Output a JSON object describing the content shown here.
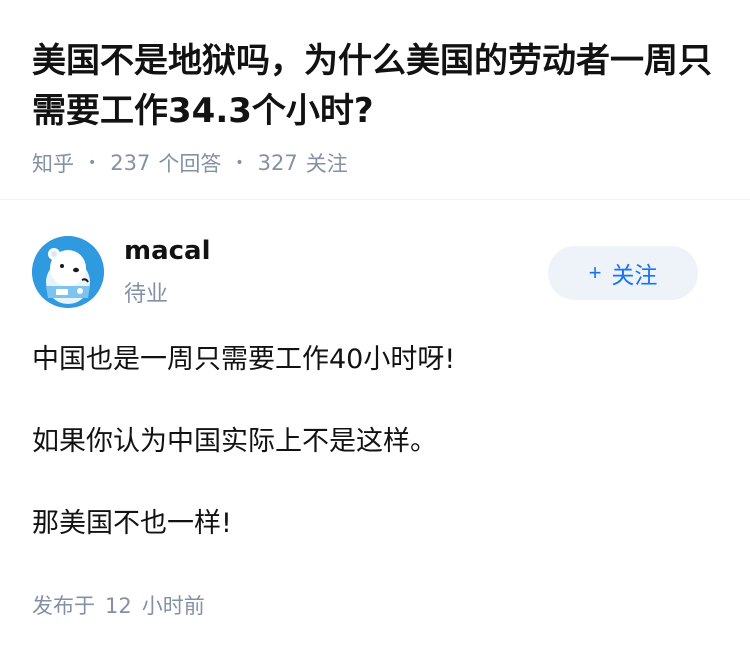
{
  "question": {
    "title": "美国不是地狱吗，为什么美国的劳动者一周只需要工作34.3个小时?",
    "source": "知乎",
    "answer_count": "237",
    "answer_label": "个回答",
    "follow_count": "327",
    "follow_label": "关注"
  },
  "author": {
    "name": "macal",
    "bio": "待业",
    "follow_button": "关注",
    "follow_plus": "+"
  },
  "answer": {
    "paragraphs": [
      "中国也是一周只需要工作40小时呀!",
      "如果你认为中国实际上不是这样。",
      "那美国不也一样!"
    ]
  },
  "footer": {
    "published_label": "发布于",
    "time_value": "12",
    "time_unit": "小时前"
  },
  "colors": {
    "accent": "#1772f6",
    "muted": "#8590a6",
    "button_bg": "#eef3fa"
  }
}
